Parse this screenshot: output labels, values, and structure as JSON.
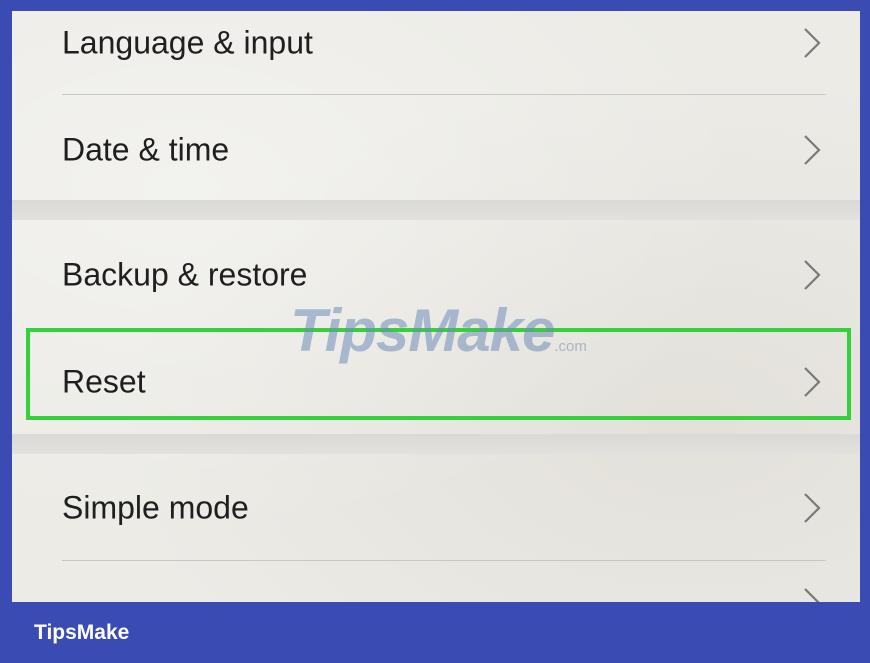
{
  "settings": {
    "items": [
      {
        "label": "Language & input",
        "chevron_icon": "chevron-right-icon"
      },
      {
        "label": "Date & time",
        "chevron_icon": "chevron-right-icon"
      },
      {
        "label": "Backup & restore",
        "chevron_icon": "chevron-right-icon"
      },
      {
        "label": "Reset",
        "chevron_icon": "chevron-right-icon",
        "highlighted": true
      },
      {
        "label": "Simple mode",
        "chevron_icon": "chevron-right-icon"
      }
    ]
  },
  "watermark": {
    "main": "TipsMake",
    "suffix": ".com"
  },
  "footer": {
    "brand": "TipsMake"
  },
  "colors": {
    "frame": "#3a4bb3",
    "highlight": "#34d13a",
    "background": "#ecebe6",
    "text": "#1f1f1f"
  }
}
